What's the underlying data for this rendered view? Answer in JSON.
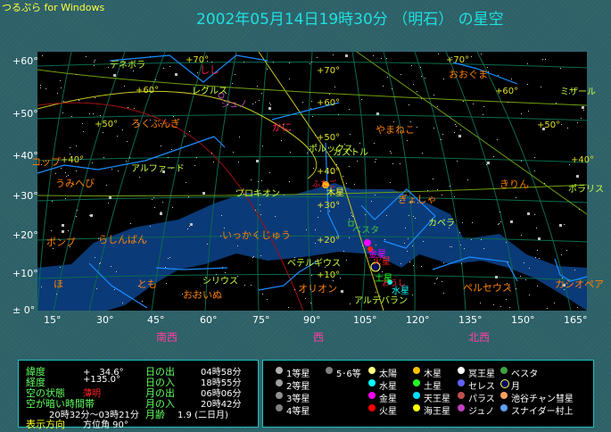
{
  "app_title": "つるぷら for Windows",
  "date_title": "2002年05月14日19時30分 （明石） の星空",
  "altitude_ticks": [
    "+60°",
    "+50°",
    "+40°",
    "+30°",
    "+20°",
    "+10°",
    "± 0°"
  ],
  "azimuth_ticks": [
    "15°",
    "30°",
    "45°",
    "60°",
    "75°",
    "90°",
    "105°",
    "120°",
    "135°",
    "150°",
    "165°"
  ],
  "directions": [
    "南西",
    "西",
    "北西"
  ],
  "grid_labels": [
    "+70°",
    "+70°",
    "+70°",
    "+60°",
    "+60°",
    "+60°",
    "+50°",
    "+50°",
    "+50°",
    "+40°",
    "+40°",
    "+40°",
    "+30°",
    "+20°",
    "+10°"
  ],
  "constellations": [
    "しし",
    "かに",
    "ろくぶんぎ",
    "コップ",
    "うみへび",
    "おおぐま",
    "やまねこ",
    "きりん",
    "ぎょしゃ",
    "いっかくじゅう",
    "ポンプ",
    "らしんばん",
    "ほ",
    "とも",
    "おおいぬ",
    "オリオン",
    "ペルセウス",
    "カシオペア",
    "ふたご",
    "おうし"
  ],
  "stars": [
    "デネボラ",
    "レグルス",
    "アルファード",
    "ミザール",
    "ポルックス",
    "カストル",
    "プロキオン",
    "ポラリス",
    "カペラ",
    "ベテルギウス",
    "シリウス",
    "アルデバラン"
  ],
  "bodies": {
    "juno": "ジュノ",
    "jupiter": "木星",
    "vesta": "ベスタ",
    "venus": "金星",
    "mars": "火星",
    "saturn": "土星",
    "mercury": "水星"
  },
  "info": {
    "lat_label": "緯度",
    "lat": "+　34.6°",
    "lon_label": "経度",
    "lon": "+135.0°",
    "sky_label": "空の状態",
    "sky": "薄明",
    "dark_label": "空が暗い時間帯",
    "dark": "20時32分〜03時21分",
    "dir_label": "表示方向",
    "dir": "方位角  90°",
    "sunrise_label": "日の出",
    "sunrise": "04時58分",
    "sunset_label": "日の入",
    "sunset": "18時55分",
    "moonrise_label": "月の出",
    "moonrise": "06時06分",
    "moonset_label": "月の入",
    "moonset": "20時42分",
    "moonage_label": "月齢",
    "moonage": "1.9 (二日月)"
  },
  "legend": [
    {
      "label": "1等星",
      "color": "#b0b0b0"
    },
    {
      "label": "2等星",
      "color": "#a0a0a0"
    },
    {
      "label": "3等星",
      "color": "#909090"
    },
    {
      "label": "4等星",
      "color": "#808080"
    },
    {
      "label": "5･6等",
      "color": "#808080"
    },
    {
      "label": "太陽",
      "color": "#ffff80"
    },
    {
      "label": "水星",
      "color": "#00ffff"
    },
    {
      "label": "金星",
      "color": "#ff00ff"
    },
    {
      "label": "火星",
      "color": "#ff0000"
    },
    {
      "label": "木星",
      "color": "#ffc000"
    },
    {
      "label": "土星",
      "color": "#20ff20"
    },
    {
      "label": "天王星",
      "color": "#00e0ff"
    },
    {
      "label": "海王星",
      "color": "#ffff00"
    },
    {
      "label": "冥王星",
      "color": "#ffffff"
    },
    {
      "label": "セレス",
      "color": "#6060ff"
    },
    {
      "label": "パラス",
      "color": "#c05050"
    },
    {
      "label": "ジュノ",
      "color": "#c040c0"
    },
    {
      "label": "ベスタ",
      "color": "#40a040"
    },
    {
      "label": "月",
      "color": "#000060"
    },
    {
      "label": "池谷チャン彗星",
      "color": "#ffa060"
    },
    {
      "label": "スナイダー村上",
      "color": "#60a0ff"
    }
  ],
  "colors": {
    "title": "#20e0e0",
    "app": "#ffff40",
    "grid": "#0a6a50",
    "milky_way": "#0a3a78",
    "const_line": "#1a8cff",
    "direction": "#ff40a0"
  }
}
